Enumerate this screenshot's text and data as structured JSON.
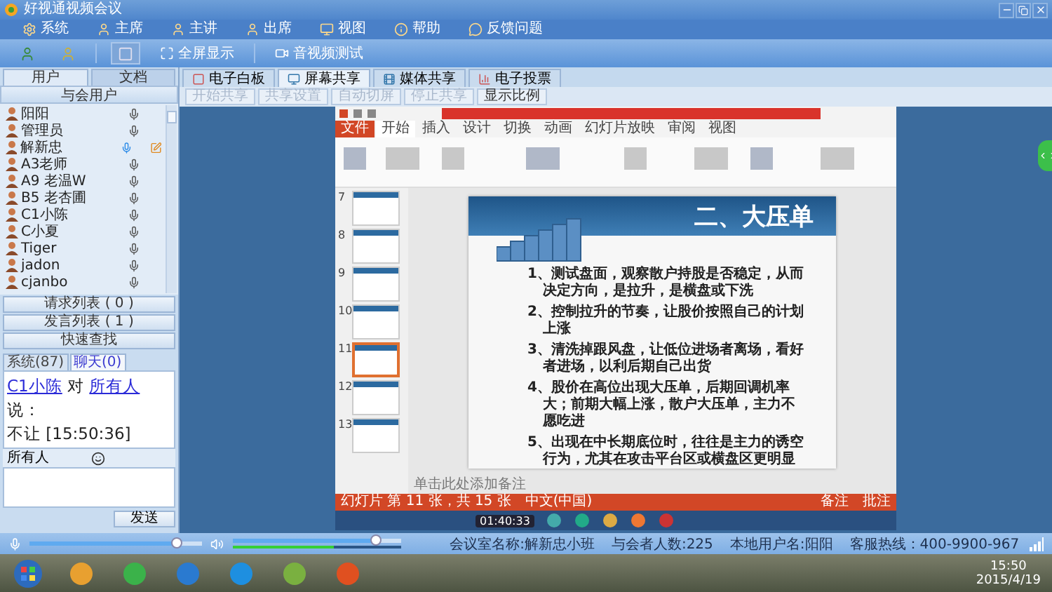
{
  "window": {
    "title": "好视通视频会议"
  },
  "menu": [
    {
      "label": "系统"
    },
    {
      "label": "主席"
    },
    {
      "label": "主讲"
    },
    {
      "label": "出席"
    },
    {
      "label": "视图"
    },
    {
      "label": "帮助"
    },
    {
      "label": "反馈问题"
    }
  ],
  "toolbar": [
    {
      "label": "全屏显示",
      "disabled": false
    },
    {
      "label": "音视频测试",
      "disabled": false
    }
  ],
  "left_tabs": [
    {
      "label": "用户",
      "selected": true
    },
    {
      "label": "文档",
      "selected": false
    }
  ],
  "users_header": "与会用户",
  "users": [
    {
      "name": "阳阳",
      "speaking": false,
      "annotate": false
    },
    {
      "name": "管理员",
      "speaking": false,
      "annotate": false
    },
    {
      "name": "解新忠",
      "speaking": true,
      "annotate": true
    },
    {
      "name": "A3老师",
      "speaking": false,
      "annotate": false
    },
    {
      "name": "A9 老温W",
      "speaking": false,
      "annotate": false
    },
    {
      "name": "B5 老杏圃",
      "speaking": false,
      "annotate": false
    },
    {
      "name": "C1小陈",
      "speaking": false,
      "annotate": false
    },
    {
      "name": "C小夏",
      "speaking": false,
      "annotate": false
    },
    {
      "name": "Tiger",
      "speaking": false,
      "annotate": false
    },
    {
      "name": "jadon",
      "speaking": false,
      "annotate": false
    },
    {
      "name": "cjanbo",
      "speaking": false,
      "annotate": false
    }
  ],
  "list_buttons": [
    "请求列表 ( 0 )",
    "发言列表 ( 1 )",
    "快速查找"
  ],
  "chat_tabs": [
    {
      "label": "系统(87)",
      "selected": false
    },
    {
      "label": "聊天(0)",
      "selected": true
    }
  ],
  "chat": [
    {
      "sender": "C1小陈",
      "connector": "对",
      "target": "所有人",
      "verb": "说：",
      "message": "不让",
      "time": "[15:50:36]"
    }
  ],
  "chat_target": "所有人",
  "send_button": "发送",
  "share_tabs": [
    {
      "label": "电子白板",
      "selected": false
    },
    {
      "label": "屏幕共享",
      "selected": true
    },
    {
      "label": "媒体共享",
      "selected": false
    },
    {
      "label": "电子投票",
      "selected": false
    }
  ],
  "share_buttons": [
    {
      "label": "开始共享",
      "disabled": true
    },
    {
      "label": "共享设置",
      "disabled": true
    },
    {
      "label": "自动切屏",
      "disabled": true
    },
    {
      "label": "停止共享",
      "disabled": true
    },
    {
      "label": "显示比例",
      "disabled": false
    }
  ],
  "shared_screen": {
    "ribbon_tabs": [
      {
        "label": "文件",
        "selected": false
      },
      {
        "label": "开始",
        "selected": true
      },
      {
        "label": "插入",
        "selected": false
      },
      {
        "label": "设计",
        "selected": false
      },
      {
        "label": "切换",
        "selected": false
      },
      {
        "label": "动画",
        "selected": false
      },
      {
        "label": "幻灯片放映",
        "selected": false
      },
      {
        "label": "审阅",
        "selected": false
      },
      {
        "label": "视图",
        "selected": false
      }
    ],
    "thumbnails": [
      {
        "number": "7",
        "selected": false
      },
      {
        "number": "8",
        "selected": false
      },
      {
        "number": "9",
        "selected": false
      },
      {
        "number": "10",
        "selected": false
      },
      {
        "number": "11",
        "selected": true
      },
      {
        "number": "12",
        "selected": false
      },
      {
        "number": "13",
        "selected": false
      }
    ],
    "slide": {
      "title": "二、大压单",
      "points": [
        "1、测试盘面，观察散户持股是否稳定，从而决定方向，是拉升，是横盘或下洗",
        "2、控制拉升的节奏，让股价按照自己的计划上涨",
        "3、清洗掉跟风盘，让低位进场者离场，看好者进场，以利后期自己出货",
        "4、股价在高位出现大压单，后期回调机率大；前期大幅上涨，散户大压单，主力不愿吃进",
        "5、出现在中长期底位时，往往是主力的诱空行为，尤其在攻击平台区或横盘区更明显"
      ]
    },
    "notes_placeholder": "单击此处添加备注",
    "status": [
      "幻灯片 第 11 张，共 15 张",
      "中文(中国)"
    ],
    "status_right": [
      "备注",
      "批注"
    ],
    "recorder_time": "01:40:33"
  },
  "status_bar": {
    "mic_slider": {
      "level": 0.85
    },
    "speaker_slider": {
      "level": 0.85
    },
    "audio_meter": {
      "level": 0.6
    },
    "room": "会议室名称:解新忠小班",
    "count": "与会者人数:225",
    "local_user": "本地用户名:阳阳",
    "hotline": "客服热线：400-9900-967"
  },
  "taskbar": {
    "time": "15:50",
    "date": "2015/4/19"
  }
}
